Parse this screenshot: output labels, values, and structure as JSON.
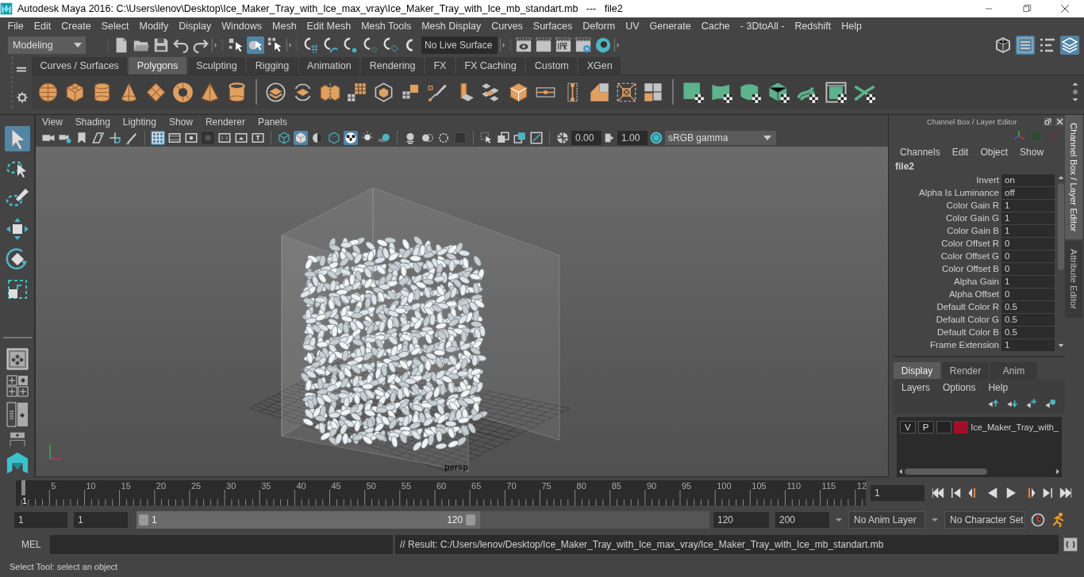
{
  "window": {
    "title": "Autodesk Maya 2016: C:\\Users\\lenov\\Desktop\\Ice_Maker_Tray_with_Ice_max_vray\\Ice_Maker_Tray_with_Ice_mb_standart.mb   ---   file2"
  },
  "menu": [
    "File",
    "Edit",
    "Create",
    "Select",
    "Modify",
    "Display",
    "Windows",
    "Mesh",
    "Edit Mesh",
    "Mesh Tools",
    "Mesh Display",
    "Curves",
    "Surfaces",
    "Deform",
    "UV",
    "Generate",
    "Cache",
    "- 3DtoAll -",
    "Redshift",
    "Help"
  ],
  "status_line": {
    "mode": "Modeling",
    "live_surface": "No Live Surface",
    "select_modes": [
      {
        "selected": false
      },
      {
        "selected": true
      },
      {
        "selected": false
      }
    ],
    "panel_toggles": [
      {
        "on": false
      },
      {
        "on": true
      },
      {
        "on": false
      },
      {
        "on": true
      }
    ]
  },
  "shelf": {
    "tabs": [
      {
        "label": "Curves / Surfaces",
        "selected": false
      },
      {
        "label": "Polygons",
        "selected": true
      },
      {
        "label": "Sculpting",
        "selected": false
      },
      {
        "label": "Rigging",
        "selected": false
      },
      {
        "label": "Animation",
        "selected": false
      },
      {
        "label": "Rendering",
        "selected": false
      },
      {
        "label": "FX",
        "selected": false
      },
      {
        "label": "FX Caching",
        "selected": false
      },
      {
        "label": "Custom",
        "selected": false
      },
      {
        "label": "XGen",
        "selected": false
      }
    ]
  },
  "toolbox": {
    "tools": [
      {
        "selected": true
      },
      {
        "selected": false
      },
      {
        "selected": false
      },
      {
        "selected": false
      },
      {
        "selected": false
      },
      {
        "selected": false
      }
    ]
  },
  "viewport": {
    "menu": [
      "View",
      "Shading",
      "Lighting",
      "Show",
      "Renderer",
      "Panels"
    ],
    "toggles": [
      {
        "on": false
      },
      {
        "on": false
      },
      {
        "on": false
      },
      {
        "on": false
      },
      {
        "on": false
      },
      {
        "on": false
      },
      {
        "on": true
      },
      {
        "on": false
      },
      {
        "on": false
      },
      {
        "on": false
      },
      {
        "on": false
      },
      {
        "on": false
      },
      {
        "on": false
      },
      {
        "on": false
      },
      {
        "on": true
      },
      {
        "on": false
      },
      {
        "on": false
      },
      {
        "on": true
      },
      {
        "on": false
      },
      {
        "on": false
      }
    ],
    "exposure": "0.00",
    "gamma": "1.00",
    "color_space": "sRGB gamma",
    "camera": "persp"
  },
  "channel_box": {
    "title": "Channel Box / Layer Editor",
    "menu": [
      "Channels",
      "Edit",
      "Object",
      "Show"
    ],
    "node": "file2",
    "attributes": [
      {
        "name": "Invert",
        "value": "on"
      },
      {
        "name": "Alpha Is Luminance",
        "value": "off"
      },
      {
        "name": "Color Gain R",
        "value": "1"
      },
      {
        "name": "Color Gain G",
        "value": "1"
      },
      {
        "name": "Color Gain B",
        "value": "1"
      },
      {
        "name": "Color Offset R",
        "value": "0"
      },
      {
        "name": "Color Offset G",
        "value": "0"
      },
      {
        "name": "Color Offset B",
        "value": "0"
      },
      {
        "name": "Alpha Gain",
        "value": "1"
      },
      {
        "name": "Alpha Offset",
        "value": "0"
      },
      {
        "name": "Default Color R",
        "value": "0.5"
      },
      {
        "name": "Default Color G",
        "value": "0.5"
      },
      {
        "name": "Default Color B",
        "value": "0.5"
      },
      {
        "name": "Frame Extension",
        "value": "1"
      }
    ]
  },
  "layer_editor": {
    "tabs": [
      {
        "label": "Display",
        "selected": true
      },
      {
        "label": "Render",
        "selected": false
      },
      {
        "label": "Anim",
        "selected": false
      }
    ],
    "menu": [
      "Layers",
      "Options",
      "Help"
    ],
    "layers": [
      {
        "visibility_label": "V",
        "playback_label": "P",
        "color": "#a0102a",
        "name": "Ice_Maker_Tray_with_"
      }
    ]
  },
  "side_tabs": [
    {
      "label": "Channel Box / Layer Editor",
      "selected": true
    },
    {
      "label": "Attribute Editor",
      "selected": false
    }
  ],
  "timeline": {
    "ticks": [
      "5",
      "10",
      "15",
      "20",
      "25",
      "30",
      "35",
      "40",
      "45",
      "50",
      "55",
      "60",
      "65",
      "70",
      "75",
      "80",
      "85",
      "90",
      "95",
      "100",
      "105",
      "110",
      "115",
      "12"
    ],
    "current_frame": "1",
    "level": 0,
    "frame_field": "1"
  },
  "range": {
    "start_field": "1",
    "playback_start_field": "1",
    "range_start": "1",
    "range_end": "120",
    "level": 0.6,
    "playback_end_field": "120",
    "end_field": "200",
    "anim_layer": "No Anim Layer",
    "character_set": "No Character Set"
  },
  "command_line": {
    "language": "MEL",
    "result": "// Result: C:/Users/lenov/Desktop/Ice_Maker_Tray_with_Ice_max_vray/Ice_Maker_Tray_with_Ice_mb_standart.mb"
  },
  "help_line": "Select Tool: select an object"
}
